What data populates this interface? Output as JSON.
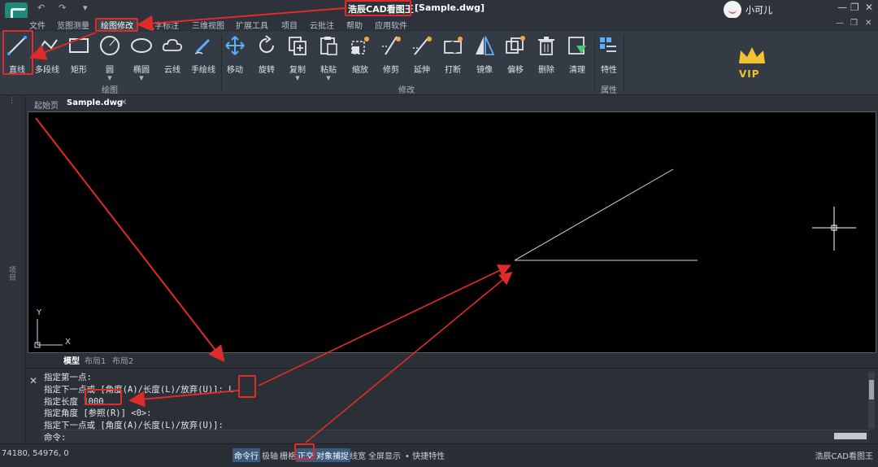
{
  "title": {
    "app": "浩辰CAD看图王",
    "file": "[Sample.dwg]"
  },
  "quick_access": [
    "↶",
    "↷",
    "▾"
  ],
  "user": {
    "name": "小可儿"
  },
  "window_controls": [
    "—",
    "❐",
    "✕"
  ],
  "menu": [
    "文件",
    "览图测量",
    "绘图修改",
    "文字标注",
    "三维视图",
    "扩展工具",
    "项目",
    "云批注",
    "帮助",
    "应用软件"
  ],
  "menu_active_index": 2,
  "mdi_controls": [
    "—",
    "❐",
    "✕"
  ],
  "ribbon": {
    "draw_tools": [
      {
        "label": "直线",
        "icon": "line-icon",
        "dropdown": false
      },
      {
        "label": "多段线",
        "icon": "polyline-icon",
        "dropdown": false
      },
      {
        "label": "矩形",
        "icon": "rectangle-icon",
        "dropdown": false
      },
      {
        "label": "圆",
        "icon": "circle-icon",
        "dropdown": true
      },
      {
        "label": "椭圆",
        "icon": "ellipse-icon",
        "dropdown": true
      },
      {
        "label": "云线",
        "icon": "cloud-icon",
        "dropdown": false
      },
      {
        "label": "手绘线",
        "icon": "pen-icon",
        "dropdown": false
      }
    ],
    "modify_tools": [
      {
        "label": "移动",
        "icon": "move-icon",
        "dropdown": false
      },
      {
        "label": "旋转",
        "icon": "rotate-icon",
        "dropdown": false
      },
      {
        "label": "复制",
        "icon": "copy-icon",
        "dropdown": true
      },
      {
        "label": "粘贴",
        "icon": "paste-icon",
        "dropdown": true
      },
      {
        "label": "缩放",
        "icon": "scale-icon",
        "dropdown": false
      },
      {
        "label": "修剪",
        "icon": "trim-icon",
        "dropdown": false
      },
      {
        "label": "延伸",
        "icon": "extend-icon",
        "dropdown": false
      },
      {
        "label": "打断",
        "icon": "break-icon",
        "dropdown": false
      },
      {
        "label": "镜像",
        "icon": "mirror-icon",
        "dropdown": false
      },
      {
        "label": "偏移",
        "icon": "offset-icon",
        "dropdown": false
      },
      {
        "label": "删除",
        "icon": "trash-icon",
        "dropdown": false
      },
      {
        "label": "清理",
        "icon": "purge-icon",
        "dropdown": false
      }
    ],
    "props_tools": [
      {
        "label": "特性",
        "icon": "properties-icon",
        "dropdown": false
      }
    ],
    "groups": {
      "draw": "绘图",
      "modify": "修改",
      "props": "属性"
    },
    "vip": "VIP"
  },
  "left_panel": {
    "label": "项目"
  },
  "doc_tabs": [
    {
      "label": "起始页",
      "active": false
    },
    {
      "label": "Sample.dwg",
      "active": true
    }
  ],
  "doc_tab_close": "✕",
  "axis": {
    "x": "X",
    "y": "Y"
  },
  "layout_tabs": [
    {
      "label": "模型",
      "active": true
    },
    {
      "label": "布局1",
      "active": false
    },
    {
      "label": "布局2",
      "active": false
    }
  ],
  "command_lines": [
    "指定第一点:",
    "指定下一点或 [角度(A)/长度(L)/放弃(U)]: L",
    "指定长度 1000",
    "指定角度 [参照(R)] <0>:",
    "指定下一点或 [角度(A)/长度(L)/放弃(U)]:"
  ],
  "command_prompt": "命令:",
  "status": {
    "coords": "74180, 54976, 0",
    "buttons": [
      {
        "label": "命令行",
        "on": true
      },
      {
        "label": "极轴",
        "on": false
      },
      {
        "label": "栅格",
        "on": false
      },
      {
        "label": "正交",
        "on": true
      },
      {
        "label": "对象捕捉",
        "on": true
      },
      {
        "label": "线宽",
        "on": false
      },
      {
        "label": "全屏显示",
        "on": false
      },
      {
        "label": "• 快捷特性",
        "on": false
      }
    ],
    "brand": "浩辰CAD看图王"
  },
  "colors": {
    "annotation": "#e02b2b",
    "canvas": "#000000",
    "drawing_line": "#d8d8d8"
  }
}
